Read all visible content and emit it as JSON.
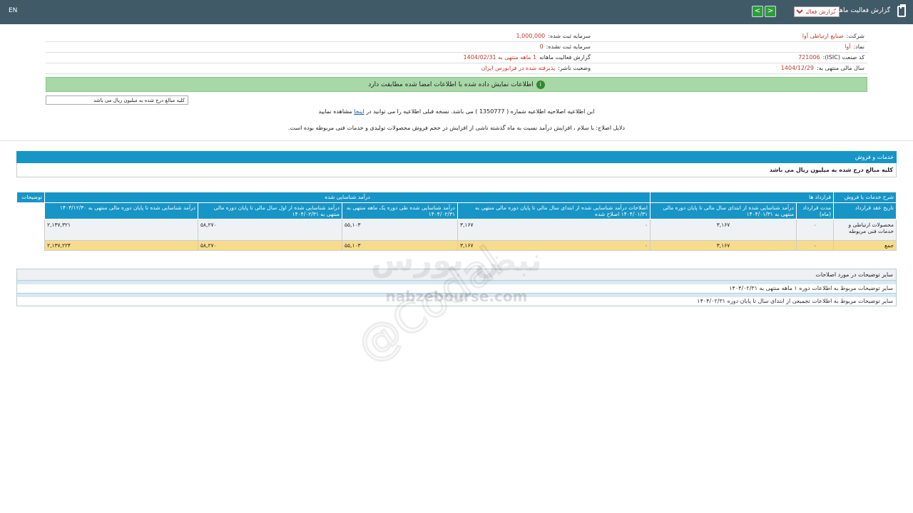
{
  "topbar": {
    "lang": "EN",
    "title": "گزارش فعالیت ماهانه",
    "select_value": "گزارش فعالیت",
    "next_label": ">",
    "prev_label": "<"
  },
  "info": {
    "company_label": "شرکت:",
    "company_value": "صنایع ارتباطی آوا",
    "capital_label": "سرمایه ثبت شده:",
    "capital_value": "1,000,000",
    "symbol_label": "نماد:",
    "symbol_value": "آوا",
    "unreg_capital_label": "سرمایه ثبت نشده:",
    "unreg_capital_value": "0",
    "isic_label": "کد صنعت (ISIC):",
    "isic_value": "721006",
    "period_label": "گزارش فعالیت ماهانه",
    "period_value": "1 ماهه منتهی به 1404/02/31",
    "fiscal_label": "سال مالی منتهی به:",
    "fiscal_value": "1404/12/29",
    "status_label": "وضعیت ناشر:",
    "status_value": "پذیرفته شده در فرابورس ایران"
  },
  "greenbar": {
    "icon": "i",
    "text": "اطلاعات نمایش داده شده با اطلاعات امضا شده مطابقت دارد"
  },
  "unit_box": "کلیه مبالغ درج شده به میلیون ریال می باشد",
  "notices": {
    "amend_pre": "این اطلاعیه اصلاحیه اطلاعیه شماره ( 1350777 ) می باشد. نسخه قبلی اطلاعیه را می توانید در",
    "amend_link": "اینجا",
    "amend_post": "مشاهده نمایید",
    "reason": "دلایل اصلاح: با سلام ، افزایش درآمد نسبت به ماه گذشته ناشی از افزایش در حجم فروش محصولات تولیدی و خدمات فنی مربوطه بوده است."
  },
  "section": {
    "title": "خدمات و فروش",
    "note": "کلیه مبالغ درج شده به میلیون ریال می باشد"
  },
  "table": {
    "h1": {
      "services": "شرح خدمات یا فروش",
      "contracts": "قرارداد ها",
      "revenue": "درآمد شناسایی شده",
      "explanations": "توضیحات"
    },
    "h2": {
      "contract_date": "تاریخ عقد قرارداد",
      "duration": "مدت قرارداد (ماه)",
      "rev_from_start": "درآمد شناسایی شده از ابتدای سال مالی تا پایان دوره مالی منتهی به ۱۴۰۴/۰۱/۳۱",
      "adjustments": "اصلاحات درآمد شناسایی شده از ابتدای سال مالی تا پایان دوره مالی منتهی به ۱۴۰۴/۰۱/۳۱ اصلاح شده",
      "rev_one_month": "درآمد شناسایی شده طی دوره یک ماهه منتهی به ۱۴۰۴/۰۲/۳۱",
      "rev_to_end": "درآمد شناسایی شده از اول سال مالی تا پایان دوره مالی منتهی به ۱۴۰۴/۰۲/۳۱",
      "rev_prev_year": "درآمد شناسایی شده تا پایان دوره مالی منتهی به ۱۴۰۳/۱۲/۳۰"
    },
    "rows": [
      {
        "service": "محصولات ارتباطی و خدمات فنی مربوطه",
        "contract_date": "",
        "duration": "۰",
        "rev_from_start": "۳,۱۶۷",
        "adjustments": "۰",
        "rev_adjusted": "۳,۱۶۷",
        "rev_one_month": "۵۵,۱۰۳",
        "rev_to_end": "۵۸,۲۷۰",
        "rev_prev_year": "۲,۱۳۷,۳۲۱"
      }
    ],
    "total": {
      "label": "جمع",
      "duration": "۰",
      "rev_from_start": "۳,۱۶۷",
      "adjustments": "۰",
      "rev_adjusted": "۳,۱۶۷",
      "rev_one_month": "۵۵,۱۰۳",
      "rev_to_end": "۵۸,۲۷۰",
      "rev_prev_year": "۲,۱۳۷,۲۲۴"
    }
  },
  "notes": {
    "header": "سایر توضیحات در مورد اصلاحات",
    "line1": "سایر توضیحات مربوط به اطلاعات دوره ۱ ماهه منتهی به ۱۴۰۴/۰۲/۳۱",
    "line2": "سایر توضیحات مربوط به اطلاعات تجمیعی از ابتدای سال تا پایان دوره ۱۴۰۴/۰۲/۳۱"
  },
  "watermark": {
    "brand": "نبض بورس",
    "url": "nabzebourse.com",
    "handle": "@Codal"
  },
  "colors": {
    "topbar": "#415a68",
    "accent": "#1795c6",
    "green": "#a8d8a8",
    "total": "#f7dc8c",
    "value_red": "#c0392b"
  }
}
